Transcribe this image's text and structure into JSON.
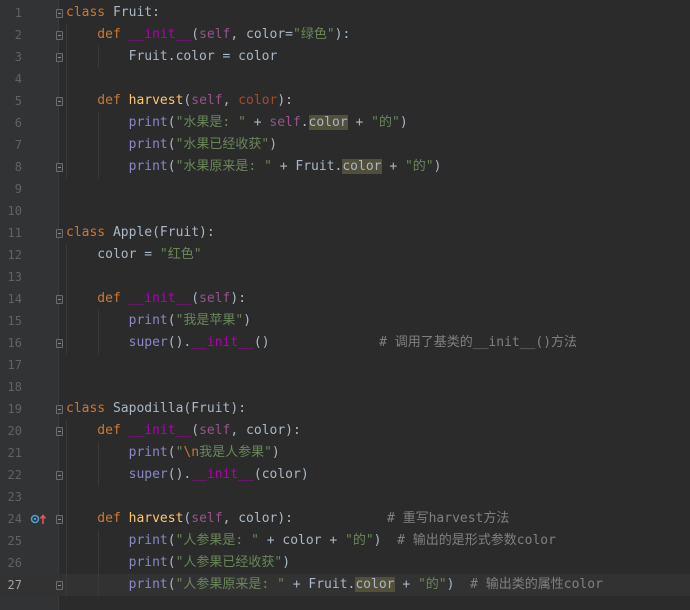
{
  "editor": {
    "lines": [
      {
        "num": "1",
        "tokens": [
          {
            "t": "class ",
            "c": "kw"
          },
          {
            "t": "Fruit",
            "c": "plain"
          },
          {
            "t": ":",
            "c": "plain"
          }
        ]
      },
      {
        "num": "2",
        "tokens": [
          {
            "t": "    def ",
            "c": "kw"
          },
          {
            "t": "__init__",
            "c": "magic"
          },
          {
            "t": "(",
            "c": "plain"
          },
          {
            "t": "self",
            "c": "self"
          },
          {
            "t": ", color=",
            "c": "plain"
          },
          {
            "t": "\"绿色\"",
            "c": "str"
          },
          {
            "t": "):",
            "c": "plain"
          }
        ]
      },
      {
        "num": "3",
        "tokens": [
          {
            "t": "        Fruit.color = color",
            "c": "plain"
          }
        ]
      },
      {
        "num": "4",
        "tokens": []
      },
      {
        "num": "5",
        "tokens": [
          {
            "t": "    def ",
            "c": "kw"
          },
          {
            "t": "harvest",
            "c": "fn"
          },
          {
            "t": "(",
            "c": "plain"
          },
          {
            "t": "self",
            "c": "self"
          },
          {
            "t": ", ",
            "c": "plain"
          },
          {
            "t": "color",
            "c": "param"
          },
          {
            "t": "):",
            "c": "plain"
          }
        ]
      },
      {
        "num": "6",
        "tokens": [
          {
            "t": "        ",
            "c": "plain"
          },
          {
            "t": "print",
            "c": "builtin"
          },
          {
            "t": "(",
            "c": "plain"
          },
          {
            "t": "\"水果是: \"",
            "c": "str"
          },
          {
            "t": " + ",
            "c": "plain"
          },
          {
            "t": "self",
            "c": "self"
          },
          {
            "t": ".",
            "c": "plain"
          },
          {
            "t": "color",
            "c": "hl"
          },
          {
            "t": " + ",
            "c": "plain"
          },
          {
            "t": "\"的\"",
            "c": "str"
          },
          {
            "t": ")",
            "c": "plain"
          }
        ]
      },
      {
        "num": "7",
        "tokens": [
          {
            "t": "        ",
            "c": "plain"
          },
          {
            "t": "print",
            "c": "builtin"
          },
          {
            "t": "(",
            "c": "plain"
          },
          {
            "t": "\"水果已经收获\"",
            "c": "str"
          },
          {
            "t": ")",
            "c": "plain"
          }
        ]
      },
      {
        "num": "8",
        "tokens": [
          {
            "t": "        ",
            "c": "plain"
          },
          {
            "t": "print",
            "c": "builtin"
          },
          {
            "t": "(",
            "c": "plain"
          },
          {
            "t": "\"水果原来是: \"",
            "c": "str"
          },
          {
            "t": " + Fruit.",
            "c": "plain"
          },
          {
            "t": "color",
            "c": "hl"
          },
          {
            "t": " + ",
            "c": "plain"
          },
          {
            "t": "\"的\"",
            "c": "str"
          },
          {
            "t": ")",
            "c": "plain"
          }
        ]
      },
      {
        "num": "9",
        "tokens": []
      },
      {
        "num": "10",
        "tokens": []
      },
      {
        "num": "11",
        "tokens": [
          {
            "t": "class ",
            "c": "kw"
          },
          {
            "t": "Apple(Fruit):",
            "c": "plain"
          }
        ]
      },
      {
        "num": "12",
        "tokens": [
          {
            "t": "    color = ",
            "c": "plain"
          },
          {
            "t": "\"红色\"",
            "c": "str"
          }
        ]
      },
      {
        "num": "13",
        "tokens": []
      },
      {
        "num": "14",
        "tokens": [
          {
            "t": "    def ",
            "c": "kw"
          },
          {
            "t": "__init__",
            "c": "magic"
          },
          {
            "t": "(",
            "c": "plain"
          },
          {
            "t": "self",
            "c": "self"
          },
          {
            "t": "):",
            "c": "plain"
          }
        ]
      },
      {
        "num": "15",
        "tokens": [
          {
            "t": "        ",
            "c": "plain"
          },
          {
            "t": "print",
            "c": "builtin"
          },
          {
            "t": "(",
            "c": "plain"
          },
          {
            "t": "\"我是苹果\"",
            "c": "str"
          },
          {
            "t": ")",
            "c": "plain"
          }
        ]
      },
      {
        "num": "16",
        "tokens": [
          {
            "t": "        ",
            "c": "plain"
          },
          {
            "t": "super",
            "c": "builtin"
          },
          {
            "t": "().",
            "c": "plain"
          },
          {
            "t": "__init__",
            "c": "magic"
          },
          {
            "t": "()              ",
            "c": "plain"
          },
          {
            "t": "# 调用了基类的__init__()方法",
            "c": "cmt"
          }
        ]
      },
      {
        "num": "17",
        "tokens": []
      },
      {
        "num": "18",
        "tokens": []
      },
      {
        "num": "19",
        "tokens": [
          {
            "t": "class ",
            "c": "kw"
          },
          {
            "t": "Sapodilla(Fruit):",
            "c": "plain"
          }
        ]
      },
      {
        "num": "20",
        "tokens": [
          {
            "t": "    def ",
            "c": "kw"
          },
          {
            "t": "__init__",
            "c": "magic"
          },
          {
            "t": "(",
            "c": "plain"
          },
          {
            "t": "self",
            "c": "self"
          },
          {
            "t": ", color):",
            "c": "plain"
          }
        ]
      },
      {
        "num": "21",
        "tokens": [
          {
            "t": "        ",
            "c": "plain"
          },
          {
            "t": "print",
            "c": "builtin"
          },
          {
            "t": "(",
            "c": "plain"
          },
          {
            "t": "\"",
            "c": "str"
          },
          {
            "t": "\\n",
            "c": "kw"
          },
          {
            "t": "我是人参果\"",
            "c": "str"
          },
          {
            "t": ")",
            "c": "plain"
          }
        ]
      },
      {
        "num": "22",
        "tokens": [
          {
            "t": "        ",
            "c": "plain"
          },
          {
            "t": "super",
            "c": "builtin"
          },
          {
            "t": "().",
            "c": "plain"
          },
          {
            "t": "__init__",
            "c": "magic"
          },
          {
            "t": "(color)",
            "c": "plain"
          }
        ]
      },
      {
        "num": "23",
        "tokens": []
      },
      {
        "num": "24",
        "tokens": [
          {
            "t": "    def ",
            "c": "kw"
          },
          {
            "t": "harvest",
            "c": "fn"
          },
          {
            "t": "(",
            "c": "plain"
          },
          {
            "t": "self",
            "c": "self"
          },
          {
            "t": ", color):            ",
            "c": "plain"
          },
          {
            "t": "# 重写harvest方法",
            "c": "cmt"
          }
        ]
      },
      {
        "num": "25",
        "tokens": [
          {
            "t": "        ",
            "c": "plain"
          },
          {
            "t": "print",
            "c": "builtin"
          },
          {
            "t": "(",
            "c": "plain"
          },
          {
            "t": "\"人参果是: \"",
            "c": "str"
          },
          {
            "t": " + color + ",
            "c": "plain"
          },
          {
            "t": "\"的\"",
            "c": "str"
          },
          {
            "t": ")  ",
            "c": "plain"
          },
          {
            "t": "# 输出的是形式参数color",
            "c": "cmt"
          }
        ]
      },
      {
        "num": "26",
        "tokens": [
          {
            "t": "        ",
            "c": "plain"
          },
          {
            "t": "print",
            "c": "builtin"
          },
          {
            "t": "(",
            "c": "plain"
          },
          {
            "t": "\"人参果已经收获\"",
            "c": "str"
          },
          {
            "t": ")",
            "c": "plain"
          }
        ]
      },
      {
        "num": "27",
        "tokens": [
          {
            "t": "        ",
            "c": "plain"
          },
          {
            "t": "print",
            "c": "builtin"
          },
          {
            "t": "(",
            "c": "plain"
          },
          {
            "t": "\"人参果原来是: \"",
            "c": "str"
          },
          {
            "t": " + Fruit.",
            "c": "plain"
          },
          {
            "t": "color",
            "c": "hl"
          },
          {
            "t": " + ",
            "c": "plain"
          },
          {
            "t": "\"的\"",
            "c": "str"
          },
          {
            "t": ")  ",
            "c": "plain"
          },
          {
            "t": "# 输出类的属性color",
            "c": "cmt"
          }
        ]
      }
    ],
    "current_line": "27",
    "icons": {
      "override_marker": "override-method-icon",
      "fold_marker": "fold-marker-icon"
    },
    "colors": {
      "background": "#2b2b2b",
      "keyword": "#cc7832",
      "string": "#6a8759",
      "comment": "#808080",
      "magic_method": "#b200b2",
      "builtin": "#8888c6",
      "self": "#94558d",
      "function": "#ffc66d"
    }
  }
}
